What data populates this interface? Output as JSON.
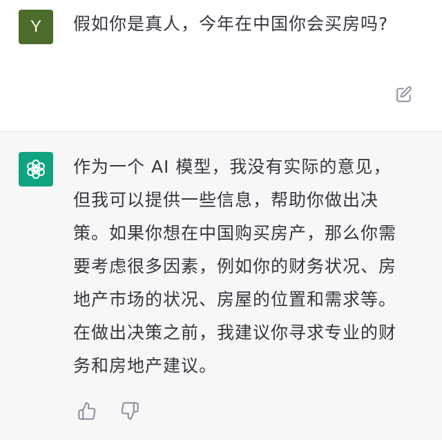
{
  "user_message": {
    "avatar_letter": "Y",
    "text": "假如你是真人，今年在中国你会买房吗?"
  },
  "assistant_message": {
    "text": "作为一个 AI 模型，我没有实际的意见，但我可以提供一些信息，帮助你做出决策。如果你想在中国购买房产，那么你需要考虑很多因素，例如你的财务状况、房地产市场的状况、房屋的位置和需求等。在做出决策之前，我建议你寻求专业的财务和房地产建议。"
  },
  "icons": {
    "edit": "edit-icon",
    "assistant_logo": "openai-logo-icon",
    "thumbs_up": "thumbs-up-icon",
    "thumbs_down": "thumbs-down-icon"
  },
  "colors": {
    "user_avatar_bg": "#4d6b2a",
    "assistant_avatar_bg": "#10a37f",
    "assistant_row_bg": "#f7f7f8",
    "text": "#353740",
    "icon": "#8e8ea0"
  }
}
